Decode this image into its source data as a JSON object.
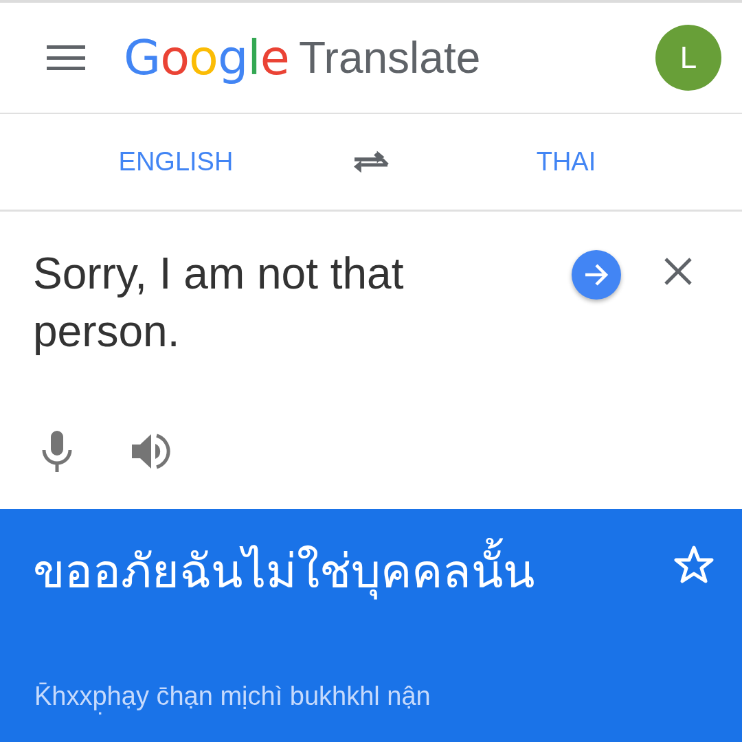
{
  "header": {
    "logo": "Google",
    "title": "Translate",
    "avatar": "L"
  },
  "languages": {
    "source": "ENGLISH",
    "target": "THAI"
  },
  "input": {
    "value": "Sorry, I am not that person."
  },
  "output": {
    "translation": "ขออภัยฉันไม่ใช่บุคคลนั้น",
    "romanization": "K̄hxxp̣hạy c̄hạn mịchì bukhkhl nận",
    "starred": false
  }
}
